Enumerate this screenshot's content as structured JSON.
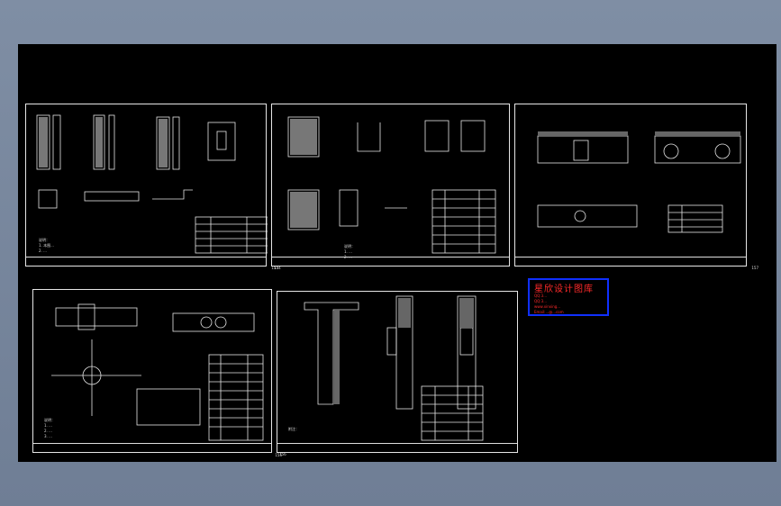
{
  "watermark": {
    "title": "星欣设计图库",
    "lines": [
      "QQ:3...",
      "QQ:3...",
      "www.xinxing...",
      "Email:...@...com"
    ]
  },
  "sheets": [
    {
      "id": "s1",
      "number": "153",
      "notes": [
        "说明：",
        "1. 本图...",
        "2. ..."
      ]
    },
    {
      "id": "s2",
      "number": "154",
      "notes": [
        "说明：",
        "1. ...",
        "2. ..."
      ]
    },
    {
      "id": "s3",
      "number": "157",
      "notes": []
    },
    {
      "id": "s4",
      "number": "155",
      "notes": [
        "说明：",
        "1. ...",
        "2. ...",
        "3. ..."
      ]
    },
    {
      "id": "s5",
      "number": "156",
      "notes": [
        "附注："
      ]
    }
  ],
  "colors": {
    "viewport_bg": "#000000",
    "line": "#e6e6e6",
    "watermark_text": "#ff2a2a",
    "watermark_border": "#1030ff"
  }
}
